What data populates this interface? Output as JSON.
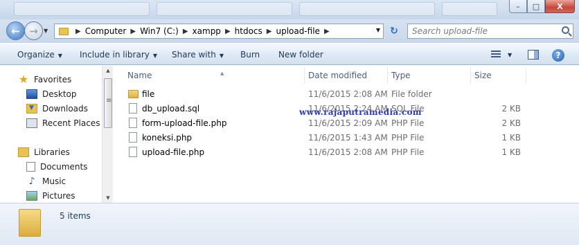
{
  "window": {
    "close_label": "X",
    "max_label": "□",
    "min_label": "–"
  },
  "address": {
    "crumbs": [
      "Computer",
      "Win7 (C:)",
      "xampp",
      "htdocs",
      "upload-file"
    ]
  },
  "search": {
    "placeholder": "Search upload-file"
  },
  "toolbar": {
    "organize": "Organize",
    "include": "Include in library",
    "share": "Share with",
    "burn": "Burn",
    "new_folder": "New folder"
  },
  "nav": {
    "favorites": "Favorites",
    "desktop": "Desktop",
    "downloads": "Downloads",
    "recent": "Recent Places",
    "libraries": "Libraries",
    "documents": "Documents",
    "music": "Music",
    "pictures": "Pictures"
  },
  "columns": {
    "name": "Name",
    "date": "Date modified",
    "type": "Type",
    "size": "Size"
  },
  "files": [
    {
      "name": "file",
      "date": "11/6/2015 2:08 AM",
      "type": "File folder",
      "size": "",
      "icon": "folder-icon"
    },
    {
      "name": "db_upload.sql",
      "date": "11/6/2015 2:24 AM",
      "type": "SQL File",
      "size": "2 KB",
      "icon": "file-icon"
    },
    {
      "name": "form-upload-file.php",
      "date": "11/6/2015 2:09 AM",
      "type": "PHP File",
      "size": "2 KB",
      "icon": "file-icon"
    },
    {
      "name": "koneksi.php",
      "date": "11/6/2015 1:43 AM",
      "type": "PHP File",
      "size": "1 KB",
      "icon": "file-icon"
    },
    {
      "name": "upload-file.php",
      "date": "11/6/2015 2:08 AM",
      "type": "PHP File",
      "size": "1 KB",
      "icon": "file-icon"
    }
  ],
  "watermark": "www.rajaputramedia.com",
  "status": {
    "count": "5 items"
  }
}
